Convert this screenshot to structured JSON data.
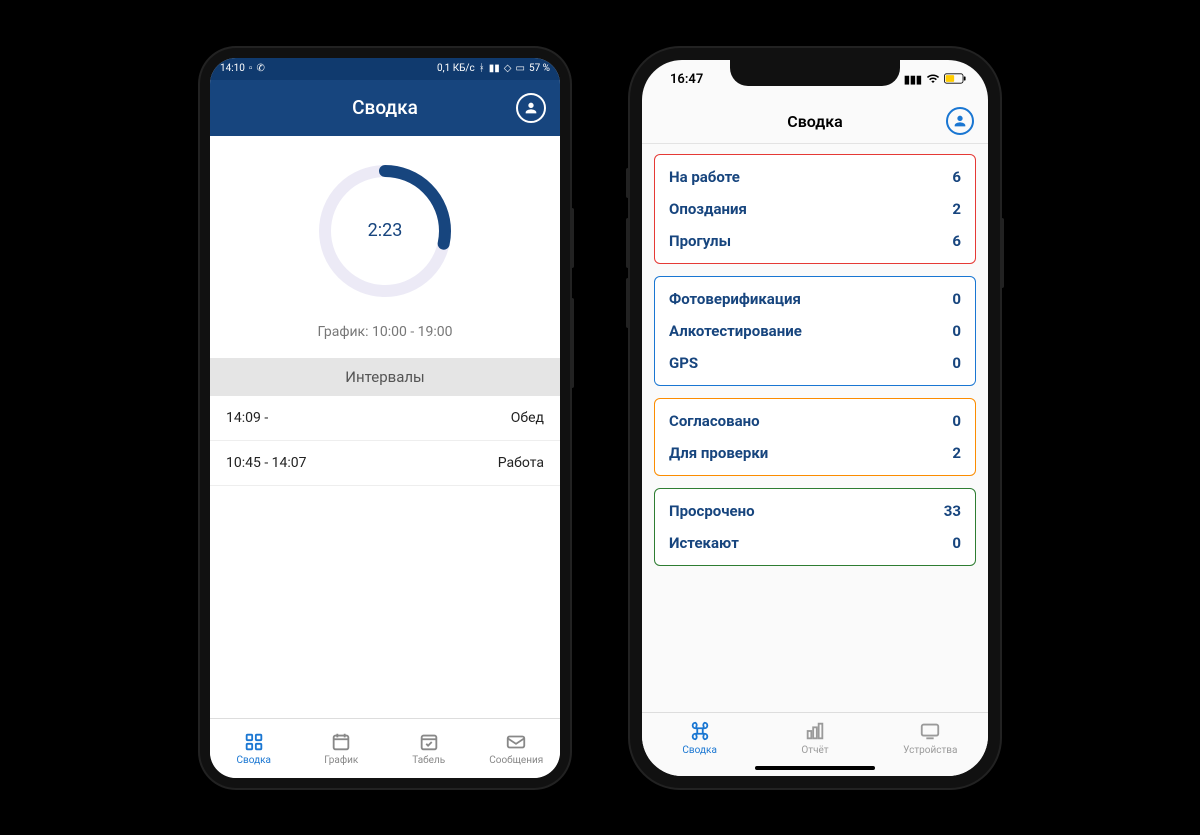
{
  "android": {
    "status": {
      "time": "14:10",
      "data_rate": "0,1 КБ/с",
      "battery": "57 %"
    },
    "header": {
      "title": "Сводка"
    },
    "summary": {
      "elapsed": "2:23",
      "schedule_label": "График: 10:00 - 19:00"
    },
    "intervals": {
      "header": "Интервалы",
      "rows": [
        {
          "time": "14:09 -",
          "type": "Обед"
        },
        {
          "time": "10:45 - 14:07",
          "type": "Работа"
        }
      ]
    },
    "tabs": [
      {
        "label": "Сводка"
      },
      {
        "label": "График"
      },
      {
        "label": "Табель"
      },
      {
        "label": "Сообщения"
      }
    ]
  },
  "ios": {
    "status": {
      "time": "16:47"
    },
    "header": {
      "title": "Сводка"
    },
    "groups": [
      {
        "color": "red",
        "rows": [
          {
            "label": "На работе",
            "value": "6"
          },
          {
            "label": "Опоздания",
            "value": "2"
          },
          {
            "label": "Прогулы",
            "value": "6"
          }
        ]
      },
      {
        "color": "blue",
        "rows": [
          {
            "label": "Фотоверификация",
            "value": "0"
          },
          {
            "label": "Алкотестирование",
            "value": "0"
          },
          {
            "label": "GPS",
            "value": "0"
          }
        ]
      },
      {
        "color": "orange",
        "rows": [
          {
            "label": "Согласовано",
            "value": "0"
          },
          {
            "label": "Для проверки",
            "value": "2"
          }
        ]
      },
      {
        "color": "green",
        "rows": [
          {
            "label": "Просрочено",
            "value": "33"
          },
          {
            "label": "Истекают",
            "value": "0"
          }
        ]
      }
    ],
    "tabs": [
      {
        "label": "Сводка"
      },
      {
        "label": "Отчёт"
      },
      {
        "label": "Устройства"
      }
    ]
  }
}
